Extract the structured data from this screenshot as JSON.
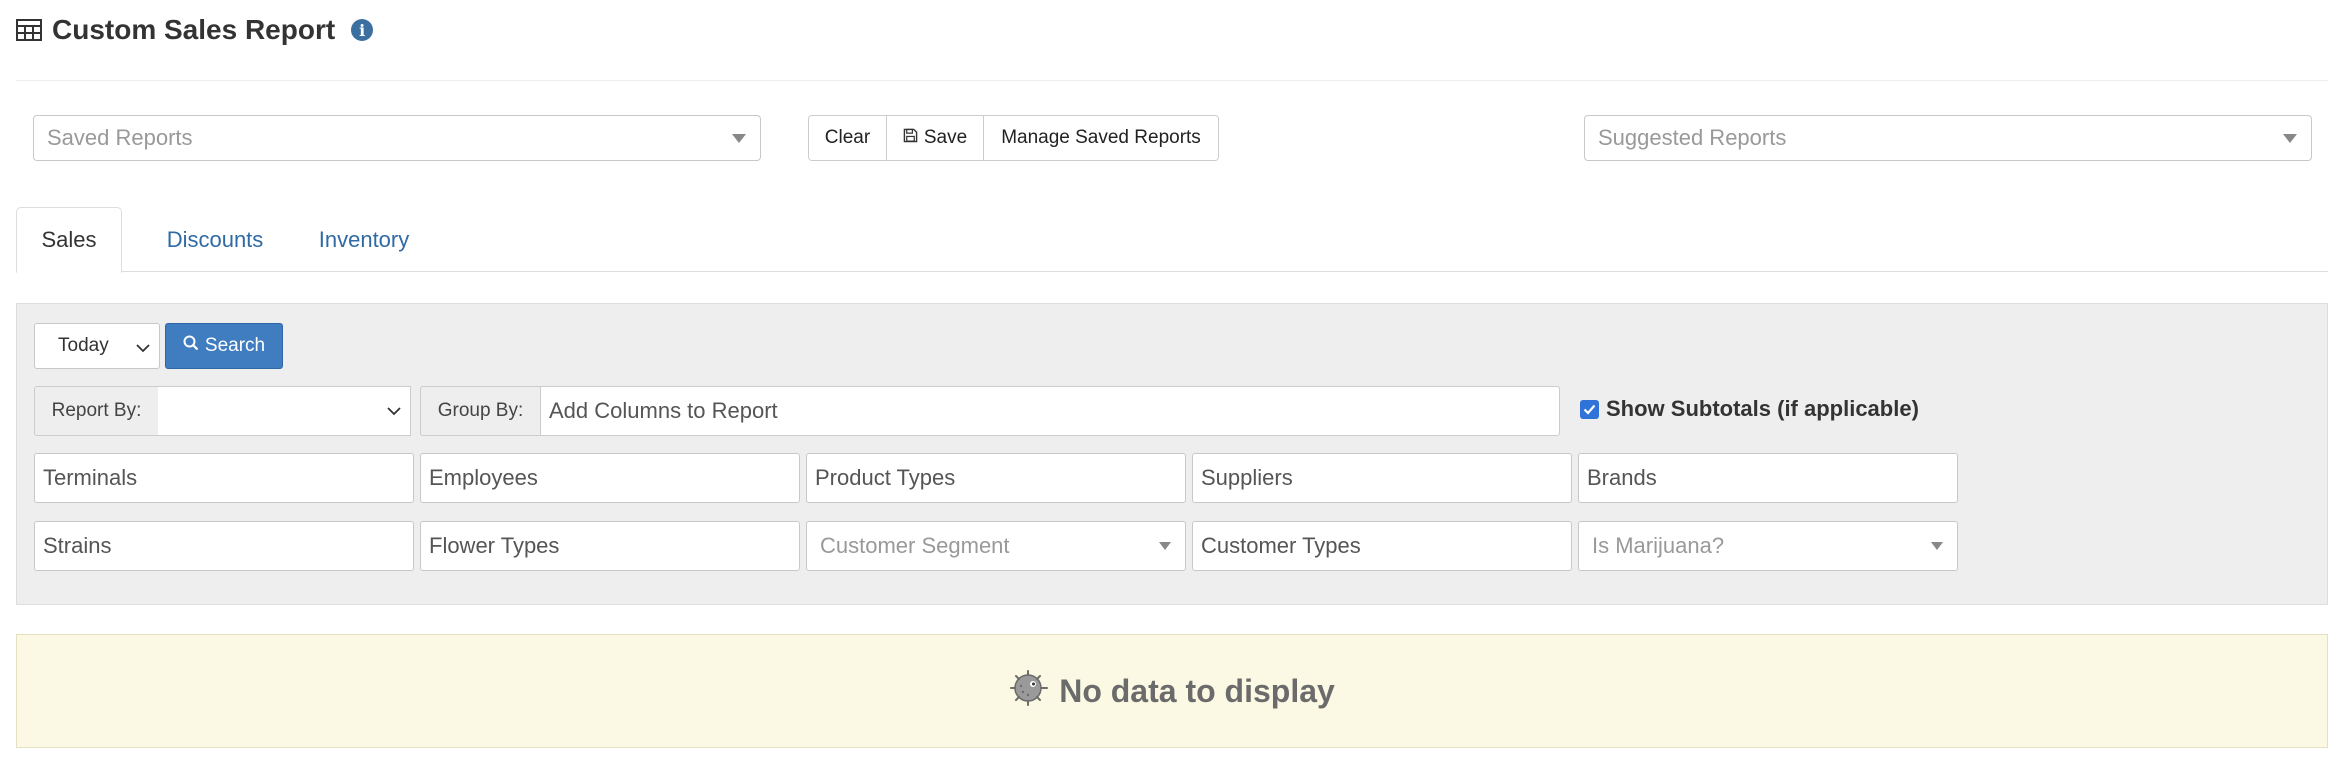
{
  "header": {
    "title": "Custom Sales Report",
    "title_icon": "table-icon",
    "info_icon": "info-icon",
    "info_glyph": "i"
  },
  "toolbar": {
    "saved_reports_placeholder": "Saved Reports",
    "clear_label": "Clear",
    "save_label": "Save",
    "manage_label": "Manage Saved Reports",
    "suggested_reports_placeholder": "Suggested Reports"
  },
  "tabs": [
    {
      "label": "Sales",
      "active": true
    },
    {
      "label": "Discounts",
      "active": false
    },
    {
      "label": "Inventory",
      "active": false
    }
  ],
  "filters": {
    "period_value": "Today",
    "search_label": "Search",
    "report_by_label": "Report By:",
    "report_by_value": "",
    "group_by_label": "Group By:",
    "group_by_placeholder": "Add Columns to Report",
    "show_subtotals_label": "Show Subtotals (if applicable)",
    "show_subtotals_checked": true,
    "row1": [
      "Terminals",
      "Employees",
      "Product Types",
      "Suppliers",
      "Brands"
    ],
    "row2": [
      "Strains",
      "Flower Types",
      "Customer Segment",
      "Customer Types",
      "Is Marijuana?"
    ]
  },
  "results": {
    "empty_message": "No data to display"
  },
  "colors": {
    "primary": "#3f7cc0",
    "link": "#2f6aa4",
    "panel_bg": "#eeeeee",
    "empty_bg": "#fbf8e3"
  }
}
